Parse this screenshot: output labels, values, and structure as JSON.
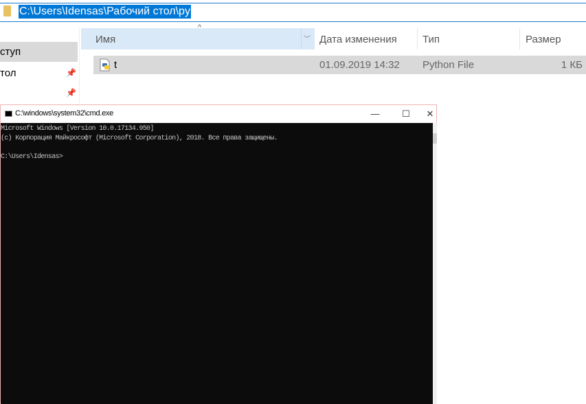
{
  "explorer": {
    "address_path": "C:\\Users\\Idensas\\Рабочий стол\\py",
    "sidebar": [
      {
        "label": "ступ",
        "selected": true
      },
      {
        "label": "тол",
        "pinned": true
      },
      {
        "label": "",
        "pinned": true
      }
    ],
    "columns": [
      "Имя",
      "Дата изменения",
      "Тип",
      "Размер"
    ],
    "files": [
      {
        "name": "t",
        "modified": "01.09.2019 14:32",
        "type": "Python File",
        "size": "1 КБ",
        "icon": "python-file-icon"
      }
    ]
  },
  "cmd": {
    "title": "C:\\windows\\system32\\cmd.exe",
    "buttons": {
      "minimize": "—",
      "maximize": "☐",
      "close": "✕"
    },
    "lines": [
      "Microsoft Windows [Version 10.0.17134.950]",
      "(c) Корпорация Майкрософт (Microsoft Corporation), 2018. Все права защищены.",
      "",
      "C:\\Users\\Idensas>"
    ]
  },
  "colors": {
    "accent": "#0078d7",
    "console_bg": "#0c0c0c",
    "header_bg": "#d9e9f7"
  }
}
